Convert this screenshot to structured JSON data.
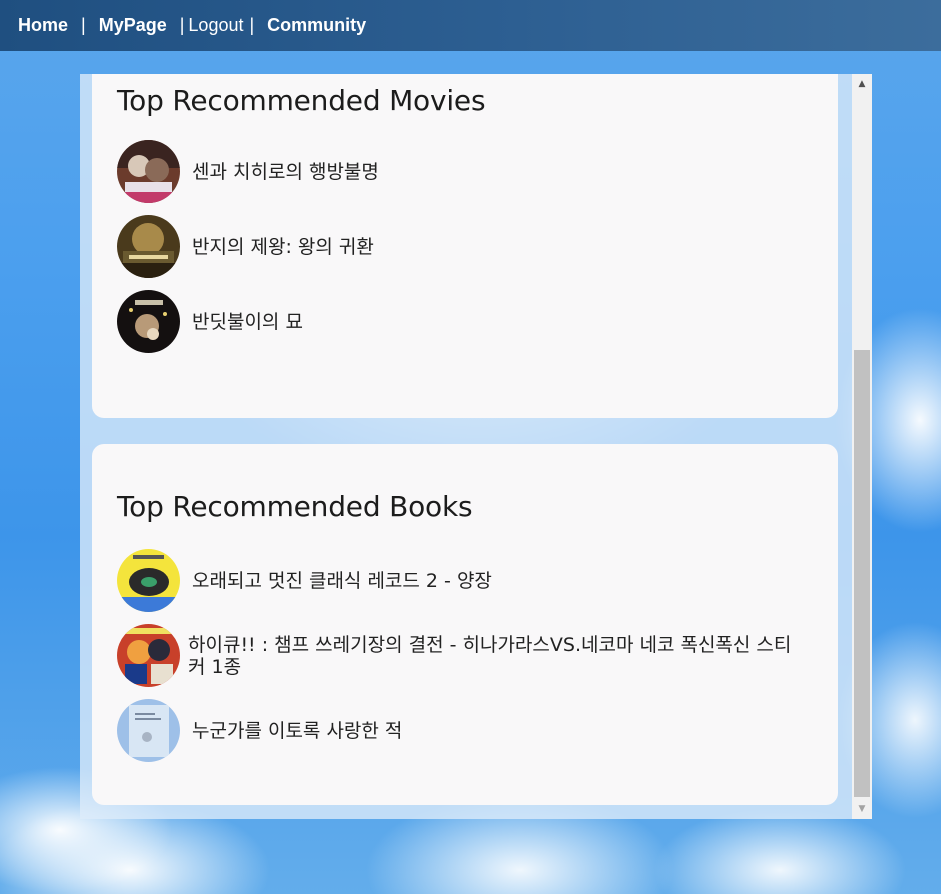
{
  "nav": {
    "home": "Home",
    "sep1": "|",
    "mypage": "MyPage",
    "sep2": "|",
    "logout": "Logout",
    "sep3": "|",
    "community": "Community"
  },
  "movies": {
    "title": "Top Recommended Movies",
    "items": [
      {
        "label": "센과 치히로의 행방불명"
      },
      {
        "label": "반지의 제왕: 왕의 귀환"
      },
      {
        "label": "반딧불이의 묘"
      }
    ]
  },
  "books": {
    "title": "Top Recommended Books",
    "items": [
      {
        "label": "오래되고 멋진 클래식 레코드 2 - 양장"
      },
      {
        "label": "하이큐!! : 챔프 쓰레기장의 결전 - 히나가라스VS.네코마 네코 폭신폭신 스티커 1종"
      },
      {
        "label": "누군가를 이토록 사랑한 적"
      }
    ]
  },
  "scrollbar": {
    "up_icon": "▲",
    "down_icon": "▼"
  }
}
